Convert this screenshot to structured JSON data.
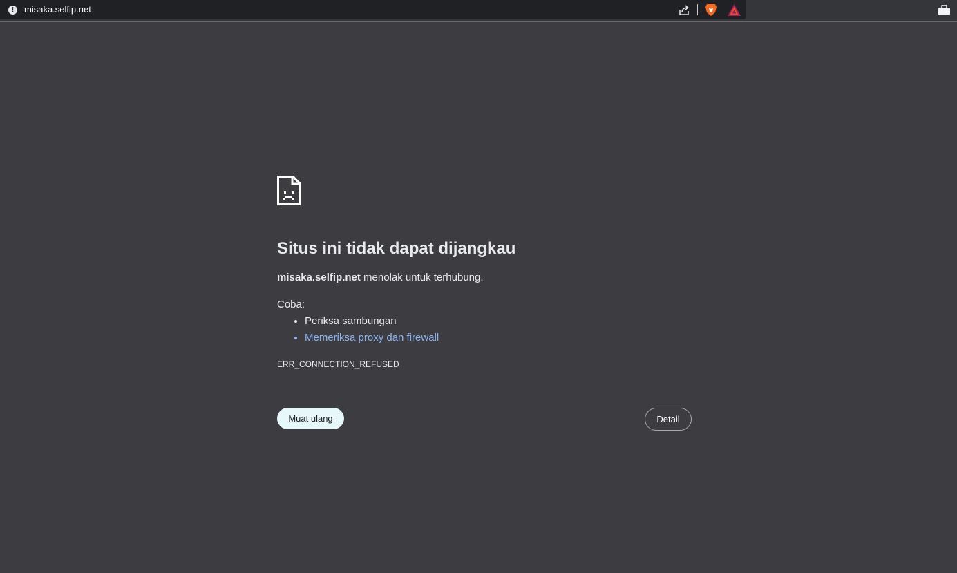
{
  "browser": {
    "url": "misaka.selfip.net",
    "icons": [
      "info-icon",
      "share-icon",
      "brave-shield-icon",
      "brave-rewards-icon",
      "extensions-icon"
    ]
  },
  "error_page": {
    "icon": "sad-page-icon",
    "title": "Situs ini tidak dapat dijangkau",
    "host": "misaka.selfip.net",
    "summary_suffix": " menolak untuk terhubung.",
    "try_label": "Coba:",
    "suggestions": [
      "Periksa sambungan",
      "Memeriksa proxy dan firewall"
    ],
    "error_code": "ERR_CONNECTION_REFUSED",
    "reload_label": "Muat ulang",
    "details_label": "Detail"
  },
  "colors": {
    "page_bg": "#3c3c41",
    "link": "#8ab4f8",
    "primary_button_bg": "#e6f8fa"
  }
}
